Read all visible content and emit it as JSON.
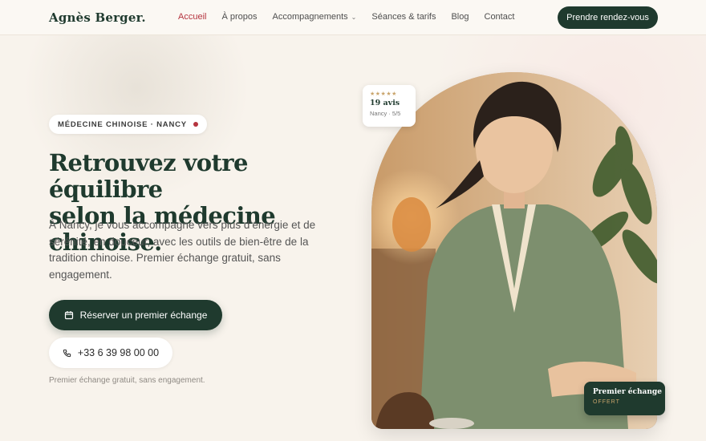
{
  "header": {
    "logo": "Agnès Berger.",
    "nav": [
      {
        "label": "Accueil"
      },
      {
        "label": "À propos"
      },
      {
        "label": "Accompagnements"
      },
      {
        "label": "Séances & tarifs"
      },
      {
        "label": "Blog"
      },
      {
        "label": "Contact"
      }
    ],
    "cta": "Prendre rendez-vous"
  },
  "hero": {
    "badge": "MÉDECINE CHINOISE · NANCY",
    "title_line1": "Retrouvez votre équilibre",
    "title_line2": "selon la médecine chinoise.",
    "description": "À Nancy, je vous accompagne vers plus d’énergie et de sérénité, en douceur, avec les outils de bien-être de la tradition chinoise. Premier échange gratuit, sans engagement.",
    "primary_button": "Réserver un premier échange",
    "phone_button": "+33 6 39 98 00 00",
    "note": "Premier échange gratuit, sans engagement."
  },
  "review_card": {
    "stars": "★★★★★",
    "count": "19 avis",
    "sub": "Nancy · 5/5"
  },
  "offer_card": {
    "title": "Premier échange",
    "sub": "OFFERT"
  },
  "colors": {
    "brand_green": "#1f3a2e",
    "accent_red": "#b5343f",
    "gold": "#c9a46b",
    "background": "#f8f3ec"
  }
}
